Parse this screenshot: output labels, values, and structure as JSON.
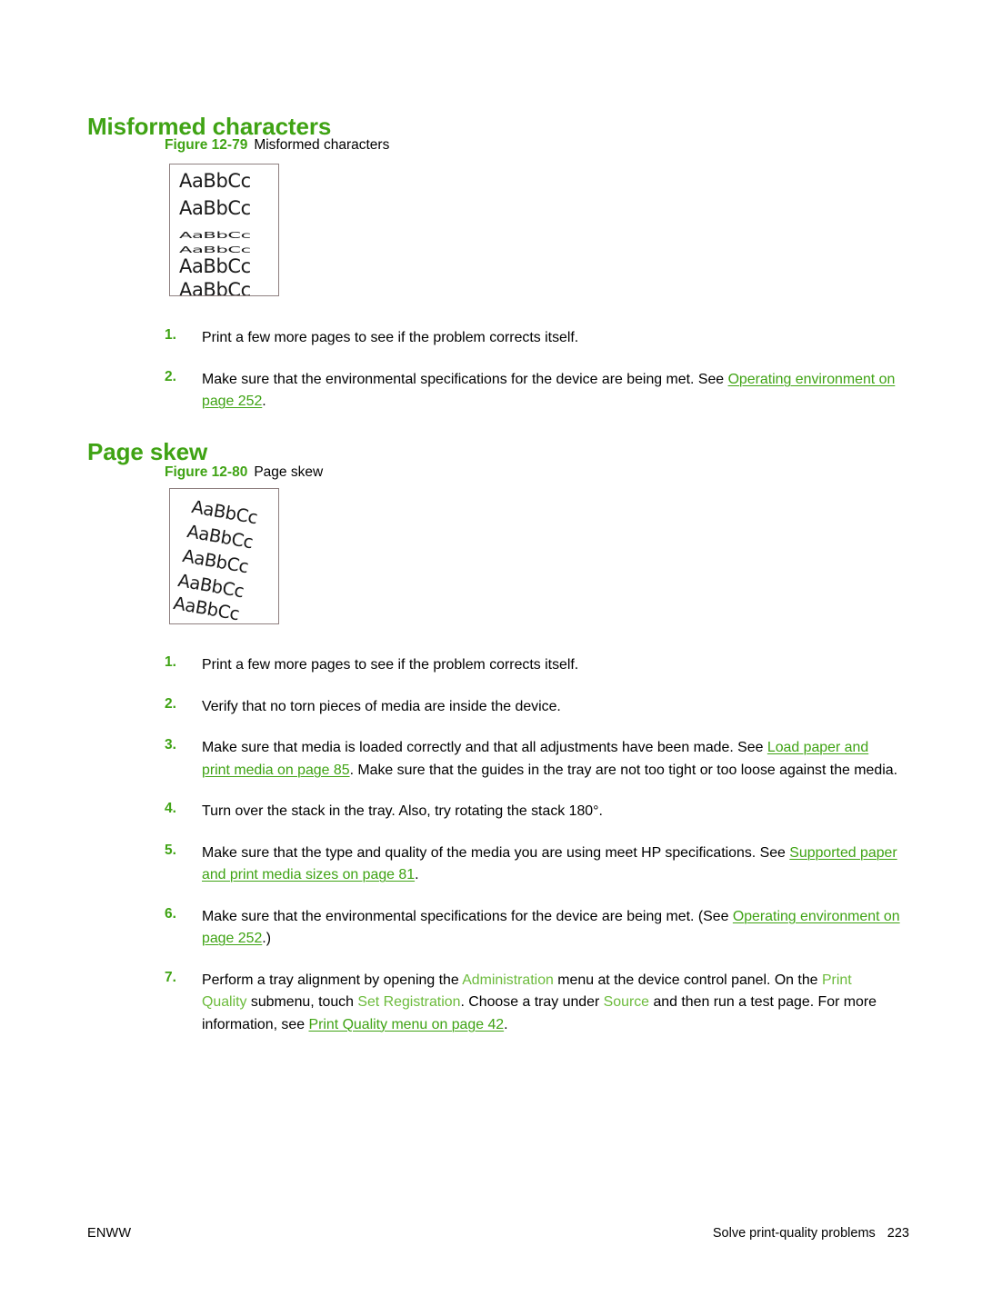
{
  "page": {
    "background_color": "#ffffff",
    "accent_green": "#3fa314",
    "ui_term_green": "#6cbb3c"
  },
  "sections": [
    {
      "heading": "Misformed characters",
      "figure": {
        "label": "Figure 12-79",
        "caption": "Misformed characters",
        "sample_text": "AaBbCc",
        "lines": [
          {
            "text": "AaBbCc",
            "style": "normal"
          },
          {
            "text": "AaBbCc",
            "style": "normal"
          },
          {
            "text": "AaBbCc",
            "style": "squished"
          },
          {
            "text": "AaBbCc",
            "style": "squished"
          },
          {
            "text": "AaBbCc",
            "style": "normal"
          },
          {
            "text": "AaBbCc",
            "style": "normal"
          }
        ]
      },
      "steps": [
        {
          "num": "1.",
          "html": "Print a few more pages to see if the problem corrects itself."
        },
        {
          "num": "2.",
          "html": "Make sure that the environmental specifications for the device are being met. See <a class=\"xref\" data-name=\"xref-operating-environment\" data-interactable=\"true\">Operating environment on page 252</a>."
        }
      ]
    },
    {
      "heading": "Page skew",
      "figure": {
        "label": "Figure 12-80",
        "caption": "Page skew",
        "sample_text": "AaBbCc",
        "lines": [
          {
            "text": "AaBbCc",
            "style": "skew"
          },
          {
            "text": "AaBbCc",
            "style": "skew"
          },
          {
            "text": "AaBbCc",
            "style": "skew"
          },
          {
            "text": "AaBbCc",
            "style": "skew"
          },
          {
            "text": "AaBbCc",
            "style": "skew"
          }
        ]
      },
      "steps": [
        {
          "num": "1.",
          "html": "Print a few more pages to see if the problem corrects itself."
        },
        {
          "num": "2.",
          "html": "Verify that no torn pieces of media are inside the device."
        },
        {
          "num": "3.",
          "html": "Make sure that media is loaded correctly and that all adjustments have been made. See <a class=\"xref\" data-name=\"xref-load-paper-and-print-media\" data-interactable=\"true\">Load paper and print media on page 85</a>. Make sure that the guides in the tray are not too tight or too loose against the media."
        },
        {
          "num": "4.",
          "html": "Turn over the stack in the tray. Also, try rotating the stack 180&#176;."
        },
        {
          "num": "5.",
          "html": "Make sure that the type and quality of the media you are using meet HP specifications. See <a class=\"xref\" data-name=\"xref-supported-paper-and-print-media-sizes\" data-interactable=\"true\">Supported paper and print media sizes on page 81</a>."
        },
        {
          "num": "6.",
          "html": "Make sure that the environmental specifications for the device are being met. (See <a class=\"xref\" data-name=\"xref-operating-environment-2\" data-interactable=\"true\">Operating environment on page 252</a>.)"
        },
        {
          "num": "7.",
          "html": "Perform a tray alignment by opening the <span class=\"uiterm\" data-name=\"ui-term-administration\" data-interactable=\"false\">Administration</span> menu at the device control panel. On the <span class=\"uiterm\" data-name=\"ui-term-print-quality\" data-interactable=\"false\">Print Quality</span> submenu, touch <span class=\"uiterm\" data-name=\"ui-term-set-registration\" data-interactable=\"false\">Set Registration</span>. Choose a tray under <span class=\"uiterm\" data-name=\"ui-term-source\" data-interactable=\"false\">Source</span> and then run a test page. For more information, see <a class=\"xref\" data-name=\"xref-print-quality-menu\" data-interactable=\"true\">Print Quality menu on page 42</a>."
        }
      ]
    }
  ],
  "footer": {
    "left": "ENWW",
    "right_title": "Solve print-quality problems",
    "page_number": "223"
  }
}
